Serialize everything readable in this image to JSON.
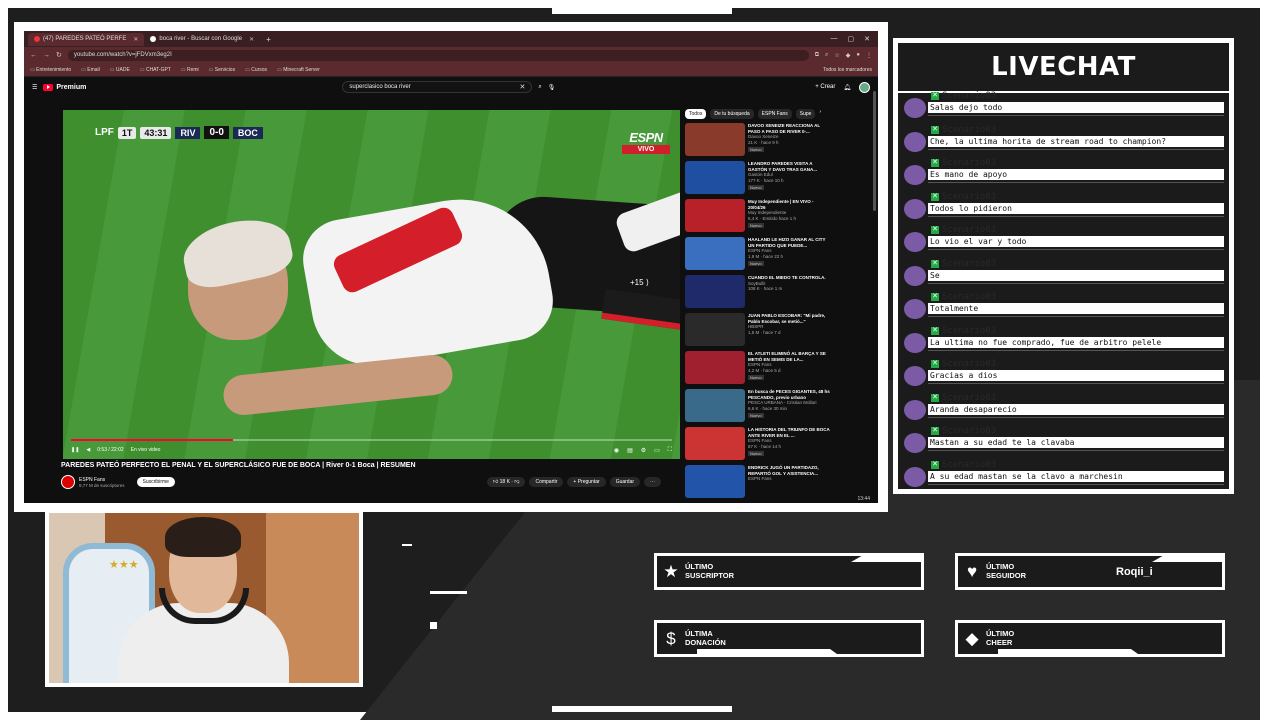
{
  "browser": {
    "tabs": [
      {
        "label": "(47) PAREDES PATEÓ PERFE",
        "active": true
      },
      {
        "label": "boca river - Buscar con Google",
        "active": false
      }
    ],
    "url": "youtube.com/watch?v=jFDVxm3eg2I",
    "bookmarks": [
      "Entretenimiento",
      "Email",
      "UADE",
      "CHAT-GPT",
      "Remi",
      "Servicios",
      "Cursos",
      "Minecraft Server"
    ],
    "bookmarks_right": "Todos los marcadores"
  },
  "youtube": {
    "logo": "Premium",
    "search_value": "superclasico boca river",
    "create_label": "+ Crear",
    "video": {
      "league": "LPF",
      "half": "1T",
      "clock": "43:31",
      "team_home": "RIV",
      "score": "0-0",
      "team_away": "BOC",
      "network": "ESPN",
      "live_badge": "VIVO",
      "skip_label": "+15",
      "time_readout": "0:53 / 22:02",
      "live_label": "En vivo video",
      "progress": 0.27
    },
    "title": "PAREDES PATEÓ PERFECTO EL PENAL Y EL SUPERCLÁSICO FUE DE BOCA | River 0-1 Boca | RESUMEN",
    "channel": {
      "name": "ESPN Fans",
      "subs": "9,77 M de suscriptores",
      "subscribe": "Suscribirme"
    },
    "actions": [
      "18 K",
      "Compartir",
      "+ Preguntar",
      "Guardar"
    ],
    "chips": [
      "Todos",
      "De tu búsqueda",
      "ESPN Fans",
      "Supe"
    ],
    "sidebar": [
      {
        "title": "DAVOO XENEIZE REACCIONA AL PASO A PASO DE RIVER 0-...",
        "channel": "Davoo Xeneize",
        "meta": "21 K · hace 9 h",
        "tag": "Nuevo",
        "color": "#8a3a2a"
      },
      {
        "title": "LEANDRO PAREDES VISITA A GASTÓN Y DAVO TRAS GANA...",
        "channel": "Gastón Edul",
        "meta": "177 K · hace 10 h",
        "tag": "Nuevo",
        "color": "#1f4fa0"
      },
      {
        "title": "Muy Independiente | EN VIVO - 20/04/26",
        "channel": "Muy Independiente",
        "meta": "5,4 K · Emitido hace 1 h",
        "tag": "Nuevo",
        "color": "#b8202a"
      },
      {
        "title": "HAALAND LE HIZO GANAR AL CITY UN PARTIDO QUE PUEDE...",
        "channel": "ESPN Fans",
        "meta": "1,9 M · hace 22 h",
        "tag": "Nuevo",
        "color": "#3a6fbf"
      },
      {
        "title": "CUANDO EL MIEDO TE CONTROLA.",
        "channel": "SoyBullit",
        "meta": "108 K · hace 1 m",
        "tag": "",
        "color": "#1e2a6a"
      },
      {
        "title": "JUAN PABLO ESCOBAR: \"Mi padre, Pablo Escobar, se metió...\"",
        "channel": "HBSPR",
        "meta": "1,5 M · hace 7 d",
        "tag": "",
        "color": "#2a2a2a"
      },
      {
        "title": "EL ATLETI ELIMINÓ AL BARÇA Y SE METIÓ EN SEMIS DE LA...",
        "channel": "ESPN Fans",
        "meta": "4,2 M · hace 5 d",
        "tag": "Nuevo",
        "color": "#a02030"
      },
      {
        "title": "En busca de PECES GIGANTES, 48 hs PESCANDO, previo urbano",
        "channel": "PESCA URBANA - Cristian Mollari",
        "meta": "6,6 K · hace 30 min",
        "tag": "Nuevo",
        "color": "#3a6a8a"
      },
      {
        "title": "LA HISTORIA DEL TRIUNFO DE BOCA ANTE RIVER EN EL ...",
        "channel": "ESPN Fans",
        "meta": "87 K · hace 14 h",
        "tag": "Nuevo",
        "color": "#c33"
      },
      {
        "title": "ENDRICK JUGÓ UN PARTIDAZO, REPARTIÓ GOL Y ASISTENCIA...",
        "channel": "ESPN Fans",
        "meta": "",
        "tag": "",
        "color": "#2255aa"
      }
    ],
    "taskbar_time": "13:44"
  },
  "livechat": {
    "title": "LIVECHAT",
    "messages": [
      {
        "user": "Scenario03",
        "text": "Salas dejo todo"
      },
      {
        "user": "Scenario03",
        "text": "Che, la ultima horita de stream road to champion?"
      },
      {
        "user": "Scenario03",
        "text": "Es mano de apoyo"
      },
      {
        "user": "Scenario03",
        "text": "Todos lo pidieron"
      },
      {
        "user": "Scenario03",
        "text": "Lo vio el var y todo"
      },
      {
        "user": "Scenario03",
        "text": "Se"
      },
      {
        "user": "Scenario03",
        "text": "Totalmente"
      },
      {
        "user": "Scenario03",
        "text": "La ultima no fue comprado, fue de arbitro pelele"
      },
      {
        "user": "Scenario03",
        "text": "Gracias a dios"
      },
      {
        "user": "Scenario03",
        "text": "Aranda desaparecio"
      },
      {
        "user": "Scenario03",
        "text": "Mastan a su edad te la clavaba"
      },
      {
        "user": "Scenario03",
        "text": "A su edad mastan se la clavo a marchesin"
      }
    ]
  },
  "alerts": {
    "suscriptor": {
      "label_1": "ÚLTIMO",
      "label_2": "SUSCRIPTOR",
      "value": ""
    },
    "seguidor": {
      "label_1": "ÚLTIMO",
      "label_2": "SEGUIDOR",
      "value": "Roqii_i"
    },
    "donacion": {
      "label_1": "ÚLTIMA",
      "label_2": "DONACIÓN",
      "value": ""
    },
    "cheer": {
      "label_1": "ÚLTIMO",
      "label_2": "CHEER",
      "value": ""
    }
  }
}
